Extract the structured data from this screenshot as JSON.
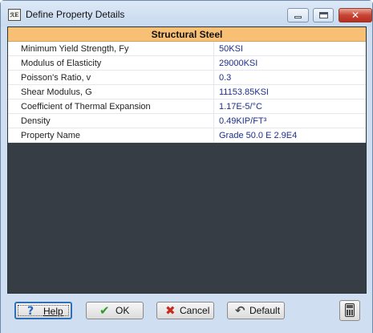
{
  "window": {
    "title": "Define Property Details",
    "icon_text": "ℛE"
  },
  "caption_buttons": {
    "minimize": "minimize-icon",
    "maximize": "maximize-icon",
    "close": "✕"
  },
  "material": {
    "header": "Structural Steel",
    "properties": [
      {
        "name": "Minimum Yield Strength, Fy",
        "value": "50KSI"
      },
      {
        "name": "Modulus of Elasticity",
        "value": "29000KSI"
      },
      {
        "name": "Poisson's Ratio, v",
        "value": "0.3"
      },
      {
        "name": "Shear Modulus, G",
        "value": "11153.85KSI"
      },
      {
        "name": "Coefficient of Thermal Expansion",
        "value": "1.17E-5/°C"
      },
      {
        "name": "Density",
        "value": "0.49KIP/FT³"
      },
      {
        "name": "Property Name",
        "value": "Grade 50.0  E 2.9E4"
      }
    ]
  },
  "footer": {
    "help_label": "Help",
    "help_icon": "?",
    "ok_label": "OK",
    "ok_icon": "✔",
    "cancel_label": "Cancel",
    "cancel_icon": "✖",
    "default_label": "Default",
    "default_icon": "↶",
    "calculator_icon": "calculator-icon"
  }
}
